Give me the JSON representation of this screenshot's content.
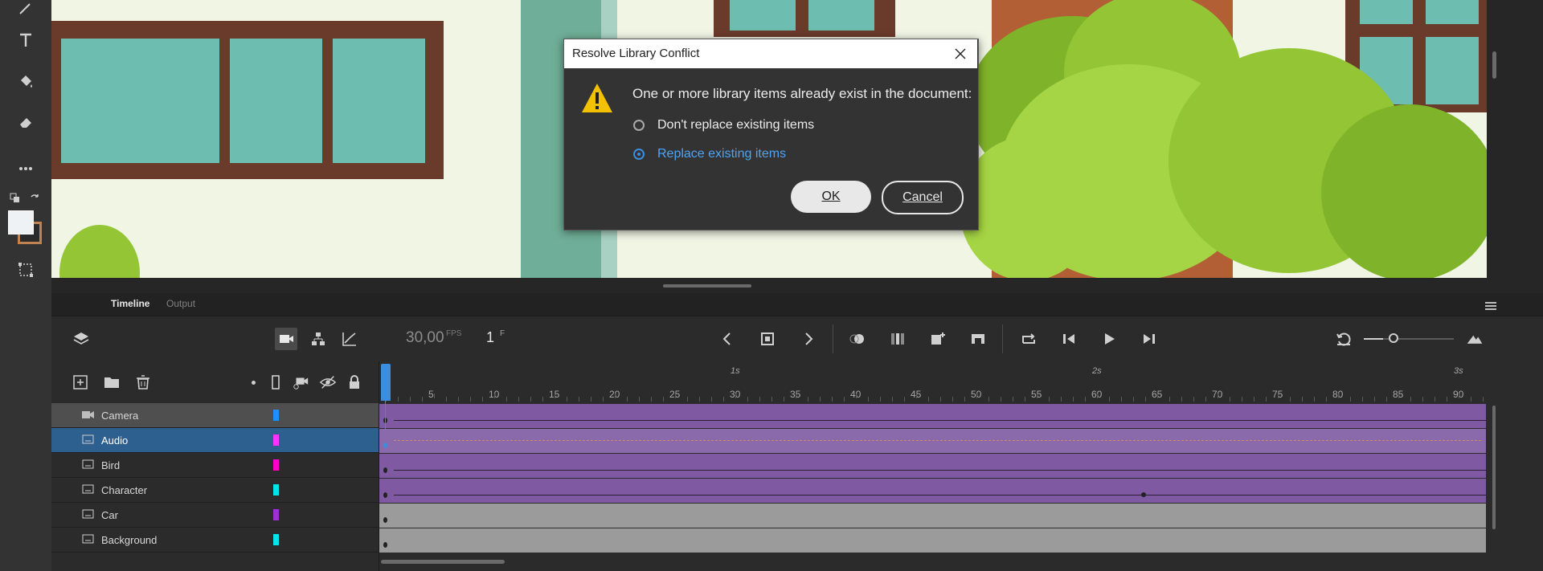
{
  "tabs": {
    "timeline": "Timeline",
    "output": "Output"
  },
  "controls": {
    "fps_value": "30,00",
    "fps_unit": "FPS",
    "frame_value": "1",
    "frame_unit": "F"
  },
  "ruler": {
    "frame_numbers": [
      "5",
      "10",
      "15",
      "20",
      "25",
      "30",
      "35",
      "40",
      "45",
      "50",
      "55",
      "60",
      "65",
      "70",
      "75",
      "80",
      "85",
      "90"
    ],
    "seconds": [
      "1s",
      "2s",
      "3s"
    ]
  },
  "layers": [
    {
      "name": "Camera",
      "color": "#1e8fff",
      "selected": false,
      "type": "camera"
    },
    {
      "name": "Audio",
      "color": "#ff33ff",
      "selected": true,
      "type": "layer"
    },
    {
      "name": "Bird",
      "color": "#ff00cc",
      "selected": false,
      "type": "layer"
    },
    {
      "name": "Character",
      "color": "#00e5e5",
      "selected": false,
      "type": "layer"
    },
    {
      "name": "Car",
      "color": "#9b30d6",
      "selected": false,
      "type": "layer"
    },
    {
      "name": "Background",
      "color": "#00e5e5",
      "selected": false,
      "type": "layer"
    }
  ],
  "dialog": {
    "title": "Resolve Library Conflict",
    "message": "One or more library items already exist in the document:",
    "options": [
      {
        "label": "Don't replace existing items",
        "selected": false
      },
      {
        "label": "Replace existing items",
        "selected": true
      }
    ],
    "ok_label": "OK",
    "cancel_label": "Cancel"
  },
  "colors": {
    "accent": "#3b8dde",
    "track_purple": "#7f5aa2",
    "track_gray": "#9b9b9b"
  }
}
